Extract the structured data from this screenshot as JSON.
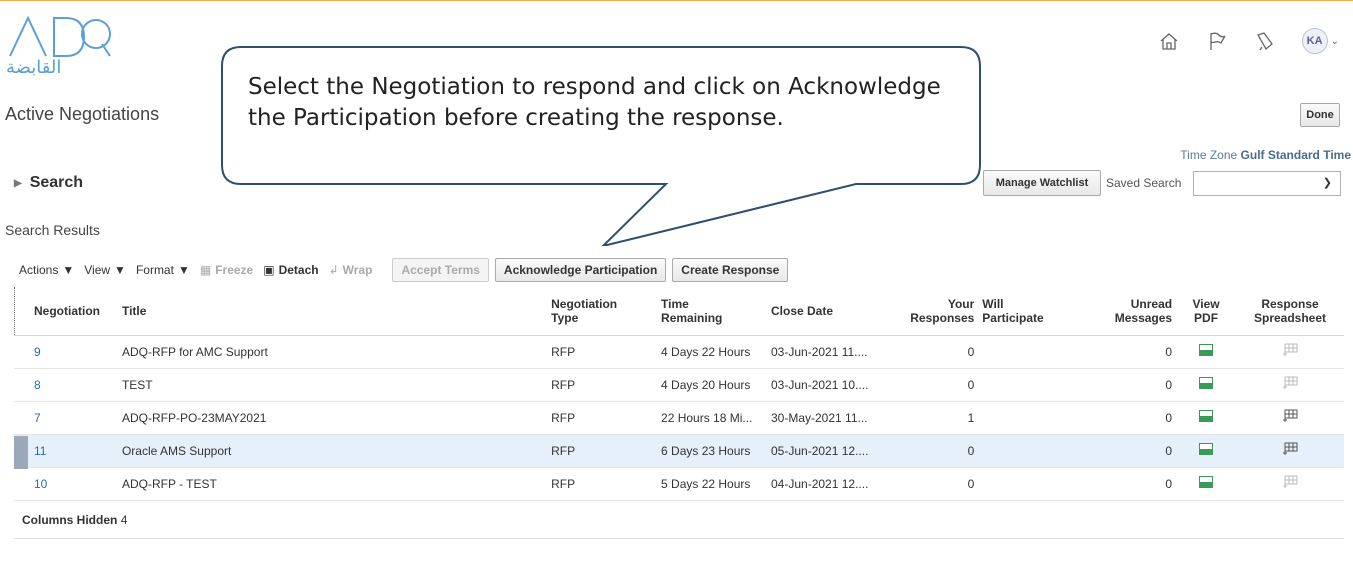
{
  "brand": {
    "logo_text": "ADQ",
    "logo_arabic": "القابضة"
  },
  "page": {
    "title": "Active Negotiations",
    "done_label": "Done"
  },
  "header": {
    "avatar_initials": "KA",
    "icons": [
      "home-icon",
      "flag-icon",
      "bell-icon"
    ]
  },
  "timezone": {
    "label": "Time Zone",
    "value": "Gulf Standard Time"
  },
  "search": {
    "label": "Search",
    "manage_watchlist": "Manage Watchlist",
    "saved_search_label": "Saved Search",
    "saved_search_value": ""
  },
  "results": {
    "title": "Search Results"
  },
  "toolbar": {
    "actions": "Actions",
    "view": "View",
    "format": "Format",
    "freeze": "Freeze",
    "detach": "Detach",
    "wrap": "Wrap",
    "accept_terms": "Accept Terms",
    "acknowledge": "Acknowledge Participation",
    "create_response": "Create Response"
  },
  "columns": {
    "negotiation": "Negotiation",
    "title": "Title",
    "type_1": "Negotiation",
    "type_2": "Type",
    "time_1": "Time",
    "time_2": "Remaining",
    "close_date": "Close Date",
    "your_1": "Your",
    "your_2": "Responses",
    "will_1": "Will",
    "will_2": "Participate",
    "unread_1": "Unread",
    "unread_2": "Messages",
    "view_pdf": "View PDF",
    "resp_1": "Response",
    "resp_2": "Spreadsheet"
  },
  "rows": [
    {
      "negotiation": "9",
      "title": "ADQ-RFP for AMC Support",
      "type": "RFP",
      "time": "4 Days 22 Hours",
      "close": "03-Jun-2021 11....",
      "responses": "0",
      "will": "",
      "unread": "0"
    },
    {
      "negotiation": "8",
      "title": "TEST",
      "type": "RFP",
      "time": "4 Days 20 Hours",
      "close": "03-Jun-2021 10....",
      "responses": "0",
      "will": "",
      "unread": "0"
    },
    {
      "negotiation": "7",
      "title": "ADQ-RFP-PO-23MAY2021",
      "type": "RFP",
      "time": "22 Hours 18 Mi...",
      "close": "30-May-2021 11...",
      "responses": "1",
      "will": "",
      "unread": "0"
    },
    {
      "negotiation": "11",
      "title": "Oracle AMS Support",
      "type": "RFP",
      "time": "6 Days 23 Hours",
      "close": "05-Jun-2021 12....",
      "responses": "0",
      "will": "",
      "unread": "0"
    },
    {
      "negotiation": "10",
      "title": "ADQ-RFP - TEST",
      "type": "RFP",
      "time": "5 Days 22 Hours",
      "close": "04-Jun-2021 12....",
      "responses": "0",
      "will": "",
      "unread": "0"
    }
  ],
  "footer": {
    "hidden_label": "Columns Hidden",
    "hidden_count": "4"
  },
  "callout": {
    "line1": "Select the Negotiation to respond and click on Acknowledge",
    "line2": "the Participation before creating the response."
  },
  "colors": {
    "link": "#2a6bb0",
    "selected_row": "#e5f0fb",
    "accent_line": "#f2b14a"
  }
}
